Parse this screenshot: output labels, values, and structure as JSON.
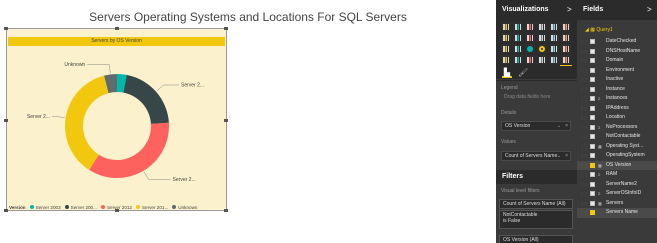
{
  "report": {
    "title": "Servers Operating Systems and Locations For SQL Servers"
  },
  "visual": {
    "header": "Servers by OS Version",
    "legend_title": "Version",
    "colors": {
      "header_bg": "#f2c80f",
      "plot_bg": "#fbf1cc"
    }
  },
  "chart_data": {
    "type": "pie",
    "variant": "donut",
    "title": "Servers by OS Version",
    "legend_title": "Version",
    "legend_position": "bottom-left",
    "slices": [
      {
        "name": "Server 2003",
        "value": 3,
        "color": "#01b8aa",
        "label": ""
      },
      {
        "name": "Server 2008",
        "value": 21,
        "color": "#374649",
        "label": "Server 2..."
      },
      {
        "name": "Server 2012",
        "value": 35,
        "color": "#fd625e",
        "label": "Server 2..."
      },
      {
        "name": "Server 2016",
        "value": 37,
        "color": "#f2c80f",
        "label": "Server 2..."
      },
      {
        "name": "Unknown",
        "value": 4,
        "color": "#5f6b6d",
        "label": "Unknown"
      }
    ],
    "legend_entries": [
      "Server 2003",
      "Server 200...",
      "Server 2012",
      "Server 201...",
      "Unknown"
    ]
  },
  "viz_pane": {
    "title": "Visualizations",
    "chevron": ">",
    "icons": [
      "stacked-bar-icon",
      "stacked-column-icon",
      "clustered-bar-icon",
      "clustered-column-icon",
      "100-bar-icon",
      "100-column-icon",
      "line-chart-icon",
      "area-chart-icon",
      "stacked-area-icon",
      "line-column-icon",
      "line-clustered-icon",
      "ribbon-chart-icon",
      "waterfall-icon",
      "scatter-icon",
      "pie-icon",
      "donut-icon",
      "treemap-icon",
      "map-icon",
      "filled-map-icon",
      "funnel-icon",
      "gauge-icon",
      "card-icon",
      "multirow-card-icon",
      "kpi-icon",
      "slicer-icon",
      "table-icon",
      "matrix-icon",
      "r-visual-icon",
      "globe-icon",
      "custom-visual-icon"
    ],
    "tabs": {
      "fields_glyph": "▙",
      "format_glyph": "🖌"
    },
    "wells": {
      "legend_label": "Legend",
      "legend_placeholder": "Drag data fields here",
      "details_label": "Details",
      "details_value": "OS Version",
      "values_label": "Values",
      "values_value": "Count of Servers Name",
      "remove_glyph": "×",
      "dropdown_glyph": "⌄"
    }
  },
  "filters": {
    "title": "Filters",
    "visual_level_label": "Visual level filters",
    "cards": [
      {
        "line1": "Count of Servers Name (All)"
      },
      {
        "line1": "NotContactable",
        "line2": "is False"
      },
      {
        "line1": "OS Version (All)"
      }
    ]
  },
  "fields_pane": {
    "title": "Fields",
    "chevron": ">",
    "table_name": "Query1",
    "fields": [
      {
        "name": "DateChecked",
        "checked": false,
        "icon": ""
      },
      {
        "name": "DNSHostName",
        "checked": false,
        "icon": ""
      },
      {
        "name": "Domain",
        "checked": false,
        "icon": ""
      },
      {
        "name": "Environment",
        "checked": false,
        "icon": ""
      },
      {
        "name": "Inactive",
        "checked": false,
        "icon": ""
      },
      {
        "name": "Instance",
        "checked": false,
        "icon": ""
      },
      {
        "name": "Instances",
        "checked": false,
        "icon": "Σ"
      },
      {
        "name": "IPAddress",
        "checked": false,
        "icon": ""
      },
      {
        "name": "Location",
        "checked": false,
        "icon": ""
      },
      {
        "name": "NoProcessors",
        "checked": false,
        "icon": "Σ"
      },
      {
        "name": "NotContactable",
        "checked": false,
        "icon": ""
      },
      {
        "name": "Operating Syst...",
        "checked": false,
        "icon": "▦"
      },
      {
        "name": "OperatingSystem",
        "checked": false,
        "icon": ""
      },
      {
        "name": "OS Version",
        "checked": true,
        "icon": "▦"
      },
      {
        "name": "RAM",
        "checked": false,
        "icon": "Σ"
      },
      {
        "name": "ServerName2",
        "checked": false,
        "icon": ""
      },
      {
        "name": "ServerOSInfoID",
        "checked": false,
        "icon": "Σ"
      },
      {
        "name": "Servers",
        "checked": false,
        "icon": "▦"
      },
      {
        "name": "Servers Name",
        "checked": true,
        "icon": ""
      }
    ]
  }
}
